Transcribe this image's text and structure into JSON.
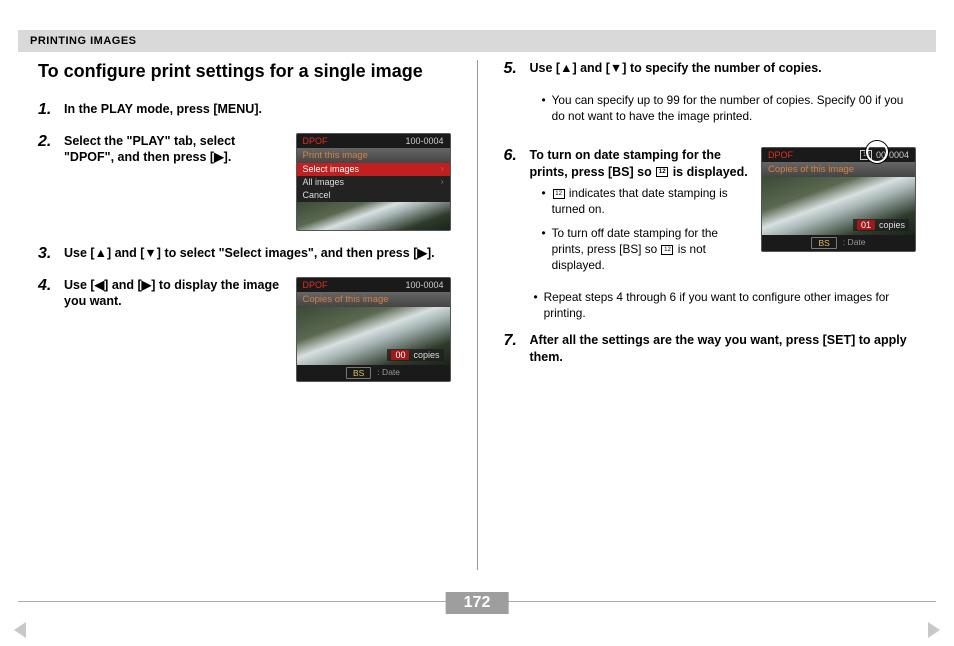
{
  "header": "PRINTING IMAGES",
  "title": "To configure print settings for a single image",
  "page_number": "172",
  "steps_left": [
    {
      "num": "1.",
      "text": "In the PLAY mode, press [MENU]."
    },
    {
      "num": "2.",
      "text": "Select the \"PLAY\" tab, select \"DPOF\", and then press [▶]."
    },
    {
      "num": "3.",
      "text": "Use [▲] and [▼] to select \"Select images\", and then press [▶]."
    },
    {
      "num": "4.",
      "text": "Use [◀] and [▶] to display the image you want."
    }
  ],
  "steps_right": [
    {
      "num": "5.",
      "text": "Use [▲] and [▼] to specify the number of copies.",
      "bullets": [
        "You can specify up to 99 for the number of copies. Specify 00 if you do not want to have the image printed."
      ]
    },
    {
      "num": "6.",
      "text_parts": [
        "To turn on date stamping for the prints, press [BS] so ",
        " is displayed."
      ],
      "bullets": [
        " indicates that date stamping is turned on.",
        "To turn off date stamping for the prints, press [BS] so  is not displayed.",
        "Repeat steps 4 through 6 if you want to configure other images for printing."
      ]
    },
    {
      "num": "7.",
      "text": "After all the settings are the way you want, press [SET] to apply them."
    }
  ],
  "cam1": {
    "dpof": "DPOF",
    "num": "100-0004",
    "title": "Print this image",
    "rows": [
      "Select images",
      "All images",
      "Cancel"
    ]
  },
  "cam2": {
    "dpof": "DPOF",
    "num": "100-0004",
    "title": "Copies of this image",
    "copies_num": "00",
    "copies_label": "copies",
    "bs": "BS",
    "date": ": Date"
  },
  "cam3": {
    "dpof": "DPOF",
    "num": "00-0004",
    "title": "Copies of this image",
    "copies_num": "01",
    "copies_label": "copies",
    "bs": "BS",
    "date": ": Date"
  }
}
